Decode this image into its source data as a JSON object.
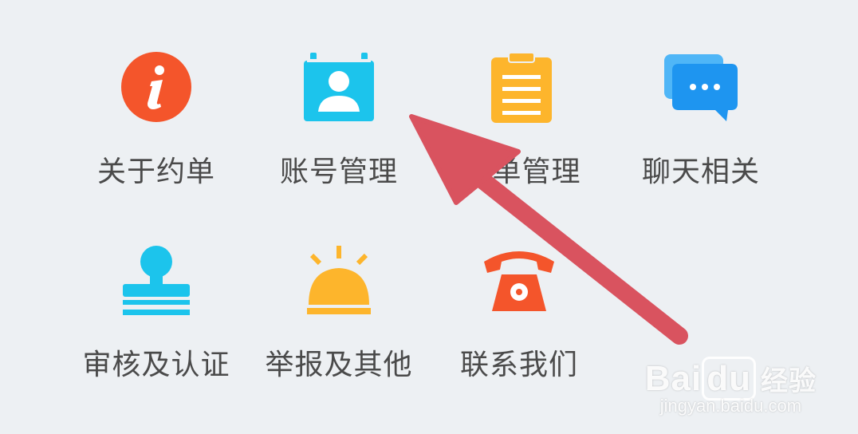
{
  "menu": {
    "items": [
      {
        "label": "关于约单",
        "icon": "info-icon",
        "color": "#f4552b"
      },
      {
        "label": "账号管理",
        "icon": "account-card-icon",
        "color": "#1cc4ec"
      },
      {
        "label": "单管理",
        "icon": "clipboard-icon",
        "color": "#fdb52c"
      },
      {
        "label": "聊天相关",
        "icon": "chat-bubbles-icon",
        "color": "#1e95f0"
      },
      {
        "label": "审核及认证",
        "icon": "stamp-icon",
        "color": "#1cc4ec"
      },
      {
        "label": "举报及其他",
        "icon": "alarm-light-icon",
        "color": "#fdb52c"
      },
      {
        "label": "联系我们",
        "icon": "telephone-icon",
        "color": "#f4552b"
      }
    ]
  },
  "annotation": {
    "arrow_color": "#d9535f"
  },
  "watermark": {
    "brand": "Bai",
    "brand_suffix": "du",
    "cn": "经验",
    "url": "jingyan.baidu.com"
  }
}
